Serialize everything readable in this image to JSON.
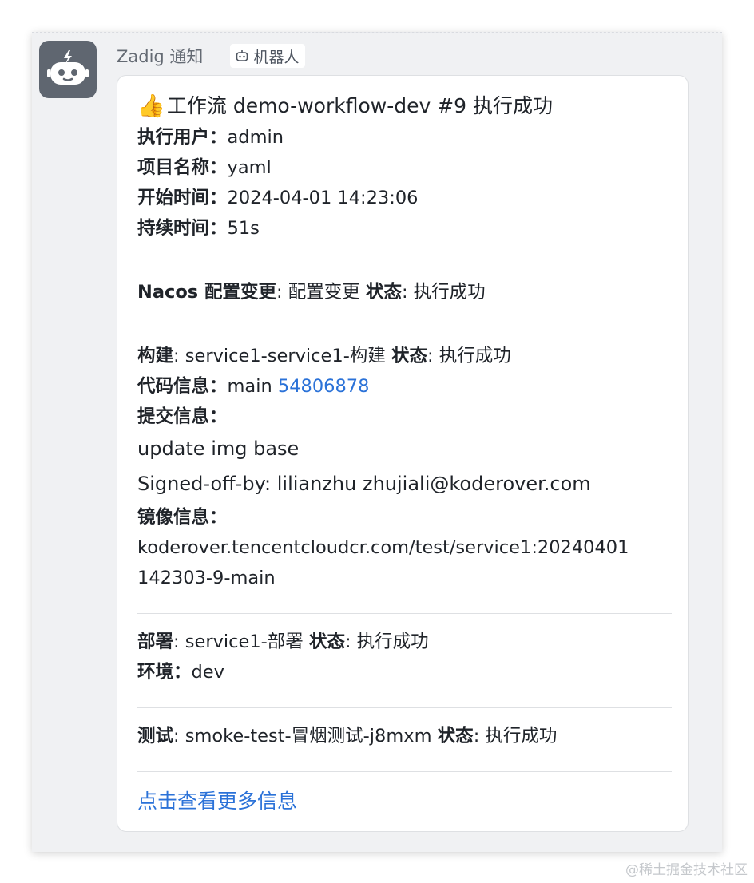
{
  "sender": {
    "name": "Zadig 通知",
    "tag_label": "机器人"
  },
  "card": {
    "title": "工作流 demo-workflow-dev #9 执行成功",
    "summary": [
      {
        "label": "执行用户：",
        "value": "admin"
      },
      {
        "label": "项目名称：",
        "value": "yaml"
      },
      {
        "label": "开始时间：",
        "value": "2024-04-01 14:23:06"
      },
      {
        "label": "持续时间：",
        "value": "51s"
      }
    ],
    "nacos": {
      "label": "Nacos 配置变更",
      "value": ": 配置变更 ",
      "status_label": "状态",
      "status_value": ": 执行成功"
    },
    "build": {
      "label": "构建",
      "value": ": service1-service1-构建 ",
      "status_label": "状态",
      "status_value": ": 执行成功",
      "code_label": "代码信息：",
      "branch": "main",
      "commit": "54806878",
      "commit_msg_label": "提交信息：",
      "commit_msg_line1": "update img base",
      "commit_msg_line2": "Signed-off-by: lilianzhu zhujiali@koderover.com",
      "image_label": "镜像信息：",
      "image_line1": "koderover.tencentcloudcr.com/test/service1:20240401",
      "image_line2": "142303-9-main"
    },
    "deploy": {
      "label": "部署",
      "value": ": service1-部署 ",
      "status_label": "状态",
      "status_value": ": 执行成功",
      "env_label": "环境：",
      "env_value": "dev"
    },
    "test": {
      "label": "测试",
      "value": ": smoke-test-冒烟测试-j8mxm ",
      "status_label": "状态",
      "status_value": ": 执行成功"
    },
    "more_link": "点击查看更多信息"
  },
  "watermark": "@稀土掘金技术社区",
  "colors": {
    "link": "#2b72d8",
    "avatar_bg": "#5f6670",
    "panel_bg": "#f0f1f3"
  },
  "icons": {
    "avatar": "robot-icon",
    "tag": "robot-icon",
    "title": "thumbs-up-icon"
  }
}
